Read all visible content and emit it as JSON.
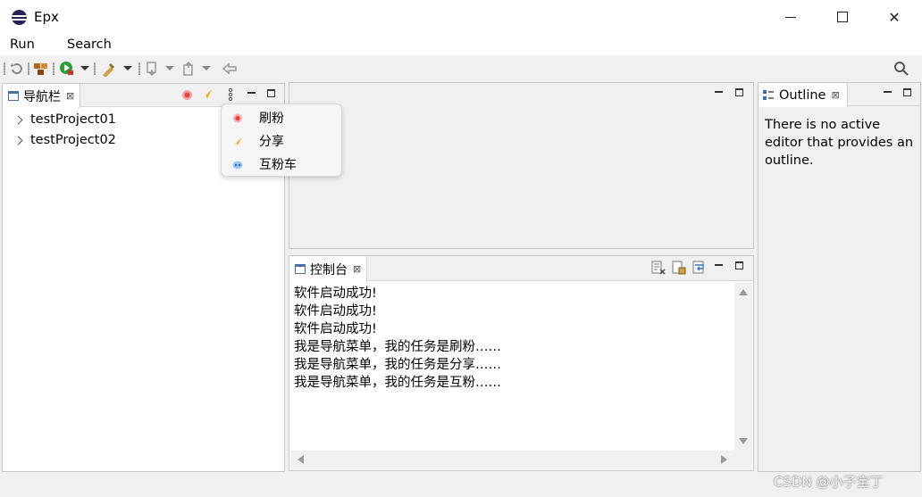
{
  "window": {
    "title": "Epx",
    "minimize_icon": "minimize-icon",
    "maximize_icon": "maximize-icon",
    "close_glyph": "✕"
  },
  "menu": {
    "items": [
      "Run",
      "Search"
    ]
  },
  "toolbar": {
    "icons": [
      "refresh-icon",
      "packages-icon",
      "run-icon",
      "tool-icon",
      "next-annotation-icon",
      "previous-annotation-icon",
      "back-icon",
      "search-icon"
    ]
  },
  "navigator": {
    "tab_label": "导航栏",
    "close_glyph": "⊠",
    "projects": [
      "testProject01",
      "testProject02"
    ]
  },
  "popup_menu": {
    "items": [
      {
        "label": "刷粉",
        "color": "#e86a6a"
      },
      {
        "label": "分享",
        "color": "#f0b43a"
      },
      {
        "label": "互粉车",
        "color": "#5a9fe0"
      }
    ]
  },
  "console": {
    "tab_label": "控制台",
    "close_glyph": "⊠",
    "lines": [
      "软件启动成功!",
      "软件启动成功!",
      "软件启动成功!",
      "我是导航菜单，我的任务是刷粉……",
      "我是导航菜单，我的任务是分享……",
      "我是导航菜单，我的任务是互粉……"
    ]
  },
  "outline": {
    "tab_label": "Outline",
    "close_glyph": "⊠",
    "message": "There is no active editor that provides an outline."
  },
  "watermark": "CSDN @小子宝丁"
}
